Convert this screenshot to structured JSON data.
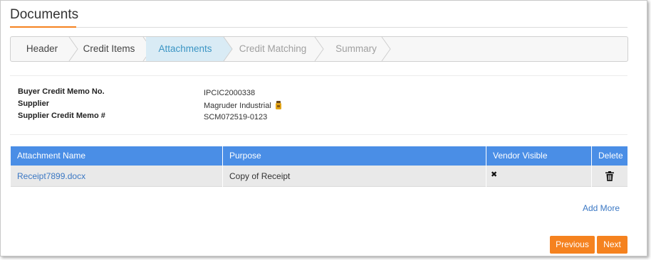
{
  "page": {
    "title": "Documents"
  },
  "wizard": {
    "steps": [
      {
        "label": "Header",
        "state": "done"
      },
      {
        "label": "Credit Items",
        "state": "done"
      },
      {
        "label": "Attachments",
        "state": "active"
      },
      {
        "label": "Credit Matching",
        "state": "disabled"
      },
      {
        "label": "Summary",
        "state": "disabled"
      }
    ]
  },
  "info": {
    "buyer_memo_label": "Buyer Credit Memo No.",
    "buyer_memo_value": "IPCIC2000338",
    "supplier_label": "Supplier",
    "supplier_value": "Magruder Industrial",
    "supplier_memo_label": "Supplier Credit Memo #",
    "supplier_memo_value": "SCM072519-0123"
  },
  "table": {
    "headers": {
      "name": "Attachment Name",
      "purpose": "Purpose",
      "vendor_visible": "Vendor Visible",
      "delete": "Delete"
    },
    "rows": [
      {
        "name": "Receipt7899.docx",
        "purpose": "Copy of Receipt",
        "vendor_visible": "✖"
      }
    ]
  },
  "actions": {
    "add_more": "Add More",
    "previous": "Previous",
    "next": "Next"
  },
  "colors": {
    "accent": "#f5821f",
    "header_blue": "#4a8ee6",
    "active_step_bg": "#d9ebf5",
    "link": "#3b78c4"
  },
  "icons": {
    "supplier": "supplier-badge-icon",
    "delete": "trash-icon"
  }
}
